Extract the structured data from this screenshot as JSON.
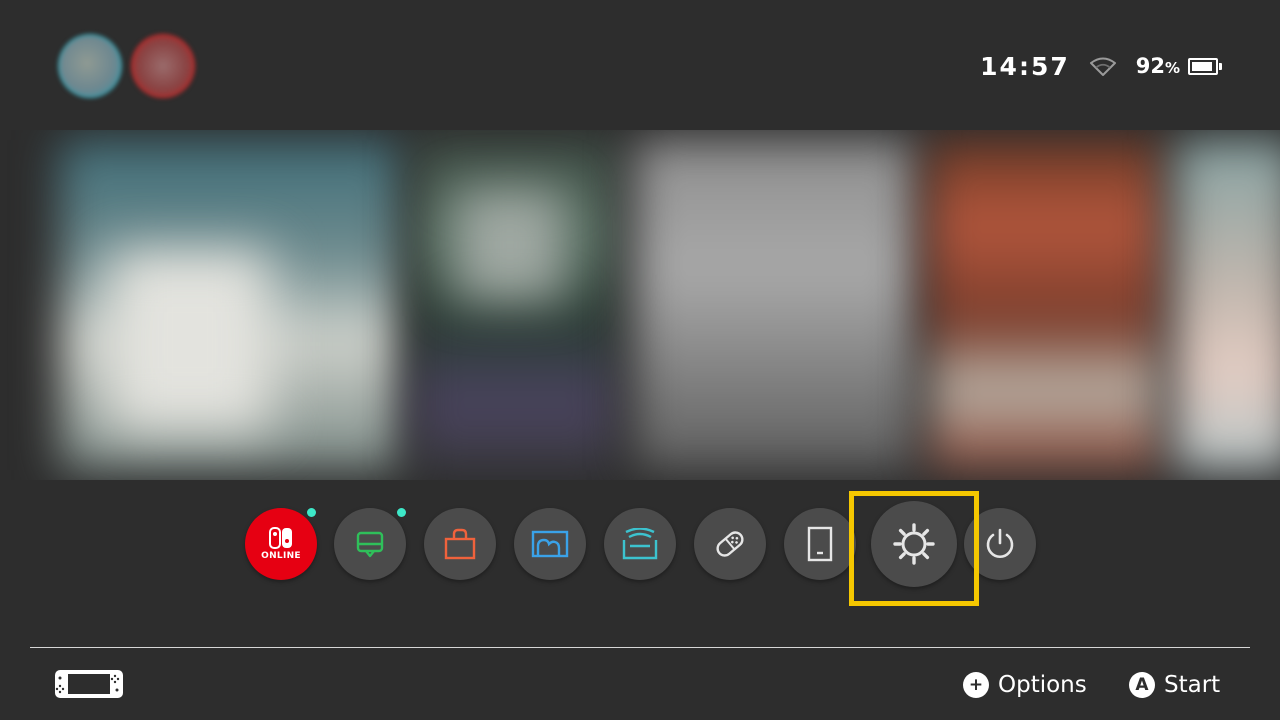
{
  "users": [
    {
      "name": "user-1",
      "ring_color": "#3aa3b2"
    },
    {
      "name": "user-2",
      "ring_color": "#c22a2a"
    }
  ],
  "status": {
    "time": "14:57",
    "battery_percent_value": "92",
    "battery_percent_symbol": "%",
    "battery_level": 0.92
  },
  "carousel": {
    "tiles": [
      "blurred-game-1",
      "blurred-game-2",
      "blurred-game-3",
      "blurred-game-4",
      "blurred-game-5"
    ]
  },
  "dock": {
    "items": [
      {
        "id": "nintendo-switch-online",
        "icon": "switch-online-icon",
        "label": "ONLINE",
        "color": "#e60012",
        "notification": true
      },
      {
        "id": "news",
        "icon": "news-icon",
        "color": "#2fbf5a",
        "notification": true
      },
      {
        "id": "eshop",
        "icon": "shopping-bag-icon",
        "color": "#f0623c",
        "notification": false
      },
      {
        "id": "album",
        "icon": "album-icon",
        "color": "#3aa2e8",
        "notification": false
      },
      {
        "id": "parental-controls",
        "icon": "parental-controls-icon",
        "color": "#3cc3cf",
        "notification": false
      },
      {
        "id": "controllers",
        "icon": "controller-icon",
        "color": "#e6e6e6",
        "notification": false
      },
      {
        "id": "screen-capture",
        "icon": "tablet-icon",
        "color": "#e6e6e6",
        "notification": false
      },
      {
        "id": "system-settings",
        "icon": "gear-icon",
        "color": "#e6e6e6",
        "notification": false,
        "selected": true
      },
      {
        "id": "sleep-mode",
        "icon": "power-icon",
        "color": "#e6e6e6",
        "notification": false
      }
    ],
    "selection_color": "#f5c700"
  },
  "footer": {
    "console_icon": "handheld-mode-icon",
    "options_button_glyph": "+",
    "options_label": "Options",
    "start_button_glyph": "A",
    "start_label": "Start"
  }
}
